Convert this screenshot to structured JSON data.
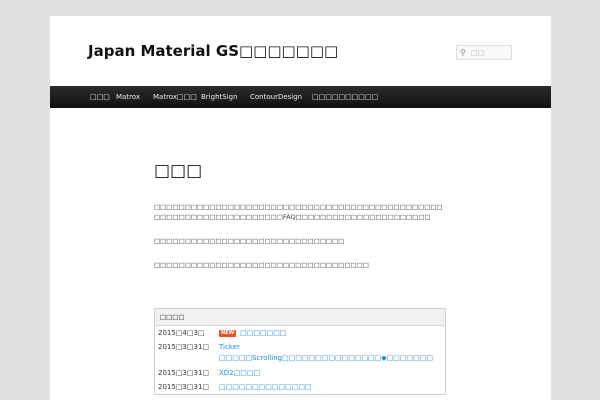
{
  "header": {
    "site_title": "Japan Material GS□□□□□□□",
    "search_icon": "magnifier-icon",
    "search_placeholder": "□□"
  },
  "nav": {
    "items": [
      {
        "label": "□□□"
      },
      {
        "label": "Matrox"
      },
      {
        "label": "Matrox□□□"
      },
      {
        "label": "BrightSign"
      },
      {
        "label": "ContourDesign"
      },
      {
        "label": "□□□□□□□□□□"
      }
    ]
  },
  "main": {
    "title": "□□□",
    "para1": "□□□□□□□□□□□□□□□□□□□□□□□□□□□□□□□□□□□□□□□□□□□□□□□□□□□□□□□□□□□□□□□□□□□□FAQ□□□□□□□□□□□□□□□□□□□□□□",
    "para2": "□□□□□□□□□□□□□□□□□□□□□□□□□□□□□□□",
    "para3": "□□□□□□□□□□□□□□□□□□□□□□□□□□□□□□□□□□□"
  },
  "news": {
    "header": "□□□□",
    "badge": "NEW",
    "rows": [
      {
        "date": "2015□4□3□",
        "title": "□□□□□□□"
      },
      {
        "date": "2015□3□31□",
        "title": "Ticker □□□□□Scrolling□□□□□□□□□□□□□□□◆□□□□□□□"
      },
      {
        "date": "2015□3□31□",
        "title": "XD2□□□□"
      },
      {
        "date": "2015□3□31□",
        "title": "□□□□□□□□□□□□□□"
      }
    ]
  },
  "colors": {
    "background": "#e2e2e2",
    "nav_bar": "#1a1a1a",
    "link": "#1b8be0",
    "badge": "#e2542a"
  }
}
